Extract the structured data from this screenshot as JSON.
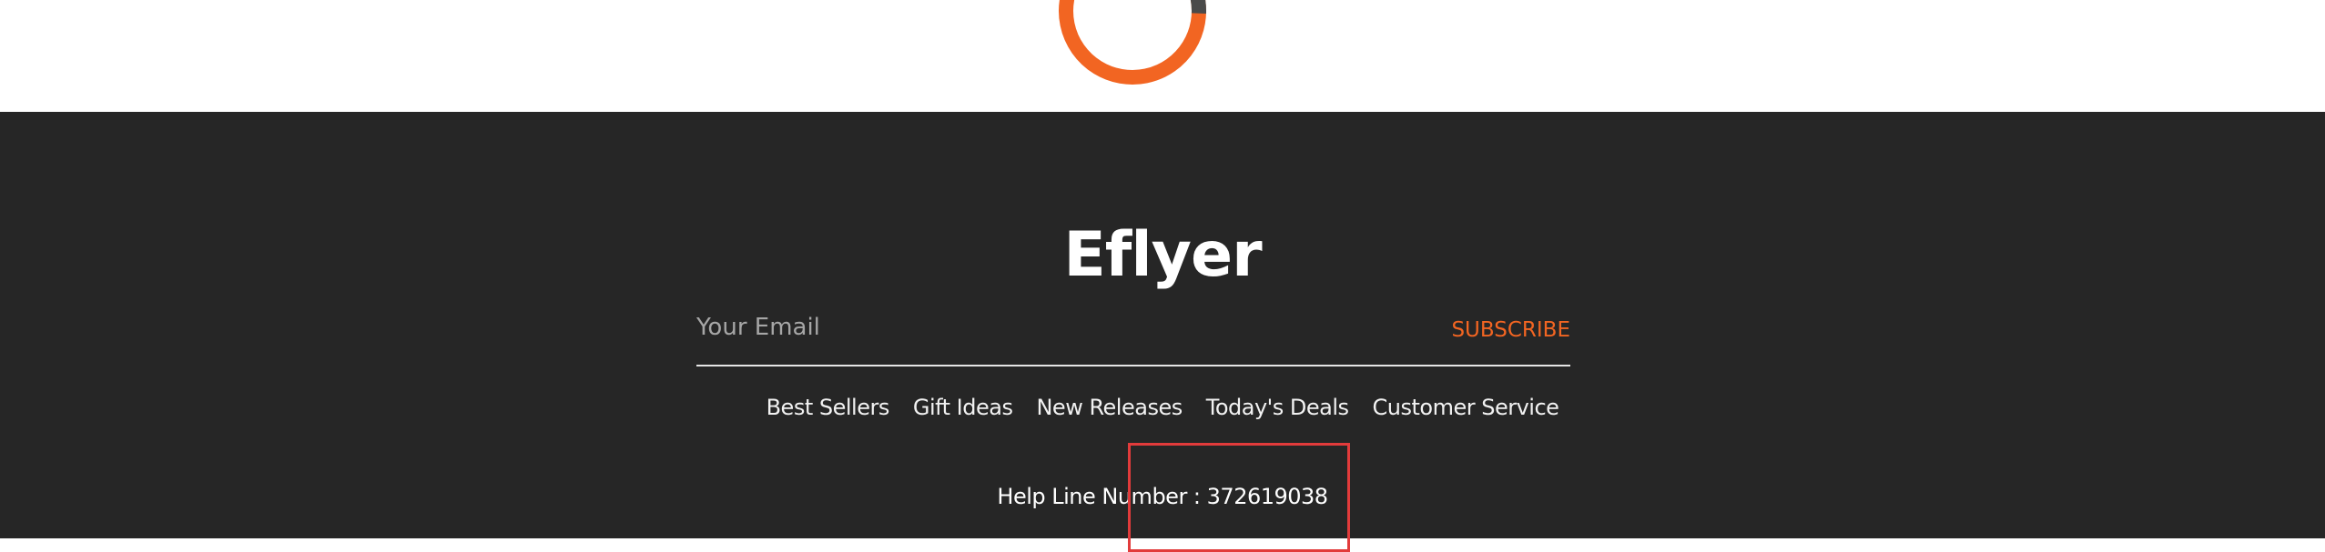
{
  "loader": {
    "icon": "loading-spinner-icon",
    "colors": {
      "primary": "#f26522",
      "secondary": "#4a4a4a"
    }
  },
  "footer": {
    "brand": "Eflyer",
    "newsletter": {
      "email_placeholder": "Your Email",
      "email_value": "",
      "subscribe_label": "SUBSCRIBE"
    },
    "nav": [
      {
        "label": "Best Sellers"
      },
      {
        "label": "Gift Ideas"
      },
      {
        "label": "New Releases"
      },
      {
        "label": "Today's Deals"
      },
      {
        "label": "Customer Service"
      }
    ],
    "helpline": "Help Line Number : 372619038",
    "colors": {
      "background": "#262626",
      "accent": "#f26522",
      "text": "#ffffff",
      "highlight": "#e23b3b"
    }
  }
}
